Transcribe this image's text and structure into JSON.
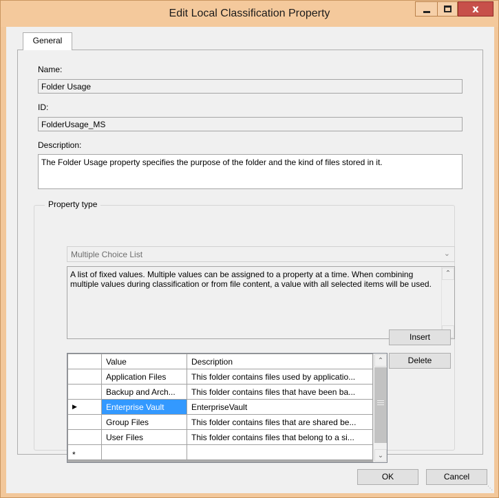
{
  "window": {
    "title": "Edit Local Classification Property",
    "controls": {
      "minimize": "minimize",
      "maximize": "maximize",
      "close": "x"
    }
  },
  "tabs": [
    {
      "label": "General"
    }
  ],
  "fields": {
    "name_label": "Name:",
    "name_value": "Folder Usage",
    "id_label": "ID:",
    "id_value": "FolderUsage_MS",
    "description_label": "Description:",
    "description_value": "The Folder Usage property specifies the purpose of the folder and the kind of files stored in it."
  },
  "property_type": {
    "group_label": "Property type",
    "selected": "Multiple Choice List",
    "help_text": "A list of fixed values. Multiple values can be assigned to a property at a time. When combining multiple values during classification or from file content, a value with all selected items will be used."
  },
  "values_grid": {
    "columns": [
      "Value",
      "Description"
    ],
    "rows": [
      {
        "value": "Application Files",
        "description": "This folder contains files used by applicatio..."
      },
      {
        "value": "Backup and Arch...",
        "description": "This folder contains files that have been ba..."
      },
      {
        "value": "Enterprise Vault",
        "description": "EnterpriseVault",
        "selected": true
      },
      {
        "value": "Group Files",
        "description": "This folder contains files that are shared be..."
      },
      {
        "value": "User Files",
        "description": "This folder contains files that belong to a si..."
      }
    ],
    "new_row_marker": "*",
    "current_row_marker": "▶"
  },
  "buttons": {
    "insert": "Insert",
    "delete": "Delete",
    "ok": "OK",
    "cancel": "Cancel"
  },
  "colors": {
    "titlebar": "#f4c99c",
    "close_button": "#c7504a",
    "selection": "#3399ff"
  }
}
